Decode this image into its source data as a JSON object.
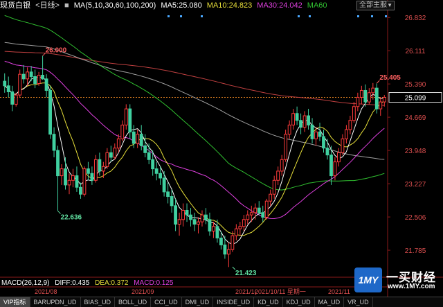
{
  "header": {
    "title": "现货白银",
    "period": "<日线>",
    "ma_params": "MA(5,10,30,60,100,200)",
    "ma5": "MA5:25.080",
    "ma10": "MA10:24.823",
    "ma30": "MA30:24.042",
    "ma60": "MA60",
    "indicator_select": "全部主服"
  },
  "colors": {
    "up": "#ff3b3b",
    "down": "#40d0a0",
    "ma5": "#ffffff",
    "ma10": "#e8e03a",
    "ma30": "#e040e0",
    "ma60": "#30c030",
    "ma100": "#a0a0a0",
    "ma200": "#c04040",
    "grid": "#8b1a1a",
    "axis_text": "#e05050",
    "date_text": "#e05050"
  },
  "macd": {
    "label": "MACD(26,12,9)",
    "diff": "DIFF:0.435",
    "dea": "DEA:0.372",
    "macd": "MACD:0.125"
  },
  "date_labels": [
    "2021/08",
    "2021/09",
    "2021/1(",
    "2021/10/11 星期一",
    "2021/11"
  ],
  "tabs": [
    "VIP指标",
    "BARUPDN_UD",
    "BIAS_UD",
    "BOLL_UD",
    "CCI_UD",
    "DMI_UD",
    "INSIDE_UD",
    "KD_UD",
    "KDJ_UD",
    "MA_UD",
    "VR_UD"
  ],
  "watermark": {
    "logo": "1MY",
    "name": "一买财经",
    "url": "www.1MY.com"
  },
  "chart_data": {
    "type": "candlestick",
    "y_ticks": [
      "26.832",
      "26.111",
      "25.390",
      "24.669",
      "23.948",
      "23.227",
      "22.506",
      "21.785"
    ],
    "ylim": [
      21.2,
      27.0
    ],
    "current_price": "25.099",
    "annotations": [
      {
        "text": "26.000",
        "index": 10,
        "value": 26.0
      },
      {
        "text": "22.636",
        "index": 14,
        "value": 22.636
      },
      {
        "text": "21.423",
        "index": 60,
        "value": 21.423
      },
      {
        "text": "25.405",
        "index": 98,
        "value": 25.405
      }
    ],
    "candles": [
      [
        25.45,
        25.62,
        25.2,
        25.35
      ],
      [
        25.35,
        25.55,
        25.1,
        25.22
      ],
      [
        25.22,
        25.35,
        24.8,
        24.95
      ],
      [
        24.95,
        25.2,
        24.9,
        25.15
      ],
      [
        25.15,
        25.7,
        25.1,
        25.6
      ],
      [
        25.6,
        25.8,
        25.4,
        25.5
      ],
      [
        25.5,
        25.75,
        25.35,
        25.65
      ],
      [
        25.65,
        25.78,
        25.45,
        25.55
      ],
      [
        25.55,
        25.7,
        25.3,
        25.4
      ],
      [
        25.4,
        25.65,
        25.35,
        25.58
      ],
      [
        25.58,
        26.0,
        25.48,
        25.5
      ],
      [
        25.5,
        25.6,
        25.1,
        25.25
      ],
      [
        25.25,
        25.35,
        24.2,
        24.3
      ],
      [
        24.3,
        24.45,
        23.8,
        23.95
      ],
      [
        23.95,
        24.05,
        22.64,
        23.4
      ],
      [
        23.4,
        23.65,
        23.2,
        23.55
      ],
      [
        23.55,
        23.8,
        23.1,
        23.2
      ],
      [
        23.2,
        23.45,
        23.0,
        23.3
      ],
      [
        23.3,
        23.55,
        23.15,
        23.4
      ],
      [
        23.4,
        23.6,
        23.05,
        23.15
      ],
      [
        23.15,
        23.25,
        22.9,
        23.0
      ],
      [
        23.0,
        23.6,
        22.95,
        23.55
      ],
      [
        23.55,
        23.7,
        23.3,
        23.45
      ],
      [
        23.45,
        23.6,
        23.2,
        23.3
      ],
      [
        23.3,
        23.85,
        23.25,
        23.75
      ],
      [
        23.75,
        23.9,
        23.4,
        23.5
      ],
      [
        23.5,
        23.7,
        23.35,
        23.6
      ],
      [
        23.6,
        24.0,
        23.55,
        23.9
      ],
      [
        23.9,
        24.05,
        23.7,
        23.8
      ],
      [
        23.8,
        24.1,
        23.75,
        24.0
      ],
      [
        24.0,
        24.3,
        23.9,
        24.2
      ],
      [
        24.2,
        24.6,
        24.15,
        24.5
      ],
      [
        24.5,
        24.95,
        24.4,
        24.85
      ],
      [
        24.85,
        24.95,
        24.2,
        24.35
      ],
      [
        24.35,
        24.5,
        24.0,
        24.1
      ],
      [
        24.1,
        24.4,
        24.0,
        24.3
      ],
      [
        24.3,
        24.5,
        23.95,
        24.05
      ],
      [
        24.05,
        24.3,
        23.8,
        23.9
      ],
      [
        23.9,
        24.1,
        23.65,
        23.75
      ],
      [
        23.75,
        23.95,
        23.4,
        23.55
      ],
      [
        23.55,
        23.7,
        23.3,
        23.45
      ],
      [
        23.45,
        23.6,
        23.2,
        23.35
      ],
      [
        23.35,
        23.5,
        22.95,
        23.05
      ],
      [
        23.05,
        23.25,
        22.8,
        22.95
      ],
      [
        22.95,
        23.1,
        22.6,
        22.75
      ],
      [
        22.75,
        22.9,
        22.2,
        22.35
      ],
      [
        22.35,
        22.6,
        22.1,
        22.45
      ],
      [
        22.45,
        22.8,
        22.3,
        22.65
      ],
      [
        22.65,
        22.8,
        22.4,
        22.55
      ],
      [
        22.55,
        22.7,
        22.3,
        22.45
      ],
      [
        22.45,
        22.6,
        22.2,
        22.35
      ],
      [
        22.35,
        22.5,
        22.15,
        22.4
      ],
      [
        22.4,
        22.65,
        22.3,
        22.55
      ],
      [
        22.55,
        22.7,
        22.35,
        22.45
      ],
      [
        22.45,
        22.6,
        22.1,
        22.2
      ],
      [
        22.2,
        22.4,
        22.05,
        22.3
      ],
      [
        22.3,
        22.45,
        21.95,
        22.05
      ],
      [
        22.05,
        22.2,
        21.8,
        21.9
      ],
      [
        21.9,
        22.1,
        21.6,
        21.7
      ],
      [
        21.7,
        21.95,
        21.42,
        21.8
      ],
      [
        21.8,
        22.2,
        21.75,
        22.1
      ],
      [
        22.1,
        22.35,
        22.0,
        22.25
      ],
      [
        22.25,
        22.4,
        22.1,
        22.3
      ],
      [
        22.3,
        22.55,
        22.2,
        22.45
      ],
      [
        22.45,
        22.65,
        22.35,
        22.55
      ],
      [
        22.55,
        22.75,
        22.4,
        22.6
      ],
      [
        22.6,
        22.8,
        22.45,
        22.7
      ],
      [
        22.7,
        22.85,
        22.55,
        22.6
      ],
      [
        22.6,
        22.75,
        22.4,
        22.5
      ],
      [
        22.5,
        22.9,
        22.45,
        22.85
      ],
      [
        22.85,
        23.1,
        22.75,
        23.0
      ],
      [
        23.0,
        23.4,
        22.9,
        23.3
      ],
      [
        23.3,
        23.6,
        23.2,
        23.5
      ],
      [
        23.5,
        23.85,
        23.4,
        23.75
      ],
      [
        23.75,
        24.4,
        23.7,
        24.3
      ],
      [
        24.3,
        24.6,
        24.2,
        24.5
      ],
      [
        24.5,
        24.85,
        24.4,
        24.75
      ],
      [
        24.75,
        24.9,
        24.5,
        24.6
      ],
      [
        24.6,
        24.75,
        24.3,
        24.45
      ],
      [
        24.45,
        24.8,
        24.35,
        24.7
      ],
      [
        24.7,
        24.85,
        24.4,
        24.5
      ],
      [
        24.5,
        24.65,
        24.1,
        24.2
      ],
      [
        24.2,
        24.45,
        24.05,
        24.35
      ],
      [
        24.35,
        24.55,
        24.15,
        24.25
      ],
      [
        24.25,
        24.4,
        23.9,
        24.0
      ],
      [
        24.0,
        24.2,
        23.75,
        23.85
      ],
      [
        23.85,
        24.05,
        23.2,
        23.4
      ],
      [
        23.4,
        23.8,
        23.3,
        23.7
      ],
      [
        23.7,
        24.0,
        23.6,
        23.9
      ],
      [
        23.9,
        24.3,
        23.85,
        24.2
      ],
      [
        24.2,
        24.5,
        24.1,
        24.4
      ],
      [
        24.4,
        24.7,
        24.3,
        24.6
      ],
      [
        24.6,
        25.0,
        24.55,
        24.9
      ],
      [
        24.9,
        25.2,
        24.8,
        25.1
      ],
      [
        25.1,
        25.35,
        24.95,
        25.25
      ],
      [
        25.25,
        25.38,
        24.9,
        25.0
      ],
      [
        25.0,
        25.3,
        24.95,
        25.2
      ],
      [
        25.2,
        25.41,
        25.05,
        25.3
      ],
      [
        25.3,
        25.4,
        24.75,
        24.85
      ],
      [
        24.85,
        25.1,
        24.7,
        25.0
      ],
      [
        25.0,
        25.15,
        24.9,
        25.1
      ]
    ]
  }
}
